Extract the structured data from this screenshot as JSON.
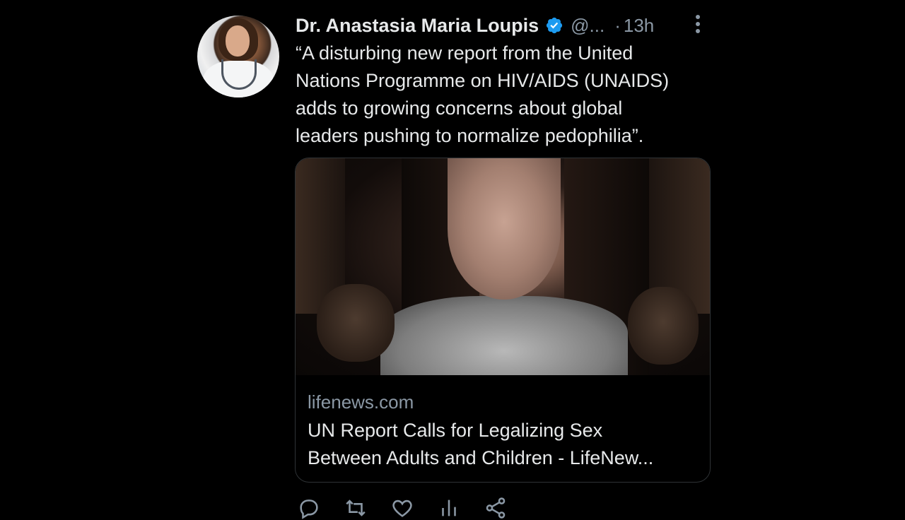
{
  "tweet": {
    "author": {
      "display_name": "Dr. Anastasia Maria Loupis",
      "handle": "@...",
      "separator": "·",
      "time": "13h"
    },
    "text": "“A disturbing new report from the United\nNations Programme on HIV/AIDS (UNAIDS)\nadds to growing concerns about global\nleaders pushing to normalize pedophilia”.",
    "card": {
      "domain": "lifenews.com",
      "title": "UN Report Calls for Legalizing Sex\nBetween Adults and Children - LifeNew..."
    },
    "actions": {
      "replies": "",
      "reposts": "",
      "likes": "",
      "views": ""
    }
  },
  "colors": {
    "background": "#000000",
    "text": "#e7e9ea",
    "secondary": "#8b98a5",
    "verified": "#1d9bf0",
    "border": "#2f3336"
  },
  "icons": {
    "verified": "verified-badge-icon",
    "more": "more-dots-icon",
    "reply": "reply-icon",
    "repost": "repost-icon",
    "like": "heart-icon",
    "views": "views-icon",
    "share": "share-icon"
  }
}
